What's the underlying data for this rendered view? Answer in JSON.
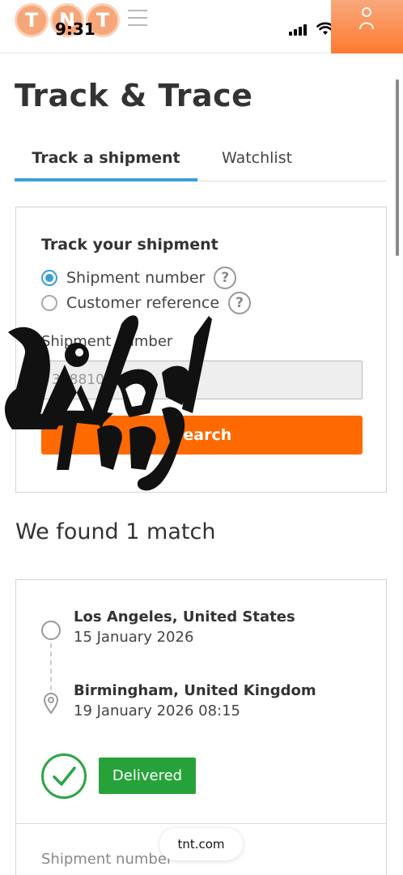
{
  "status_bar": {
    "time": "9:31"
  },
  "header": {
    "logo_letters": [
      "T",
      "N",
      "T"
    ],
    "brand_color": "#ff6a00"
  },
  "page": {
    "title": "Track & Trace"
  },
  "tabs": [
    {
      "label": "Track a shipment",
      "active": true
    },
    {
      "label": "Watchlist",
      "active": false
    }
  ],
  "search_card": {
    "heading": "Track your shipment",
    "options": [
      {
        "label": "Shipment number",
        "selected": true
      },
      {
        "label": "Customer reference",
        "selected": false
      }
    ],
    "help_glyph": "?",
    "field_label": "Shipment number",
    "field_value": "328810162",
    "button_label": "Search"
  },
  "results": {
    "heading": "We found 1 match",
    "origin": {
      "city": "Los Angeles, United States",
      "date": "15 January 2026"
    },
    "destination": {
      "city": "Birmingham, United Kingdom",
      "date": "19 January 2026 08:15"
    },
    "status": "Delivered",
    "status_color": "#27a23b",
    "next_label": "Shipment number"
  },
  "browser": {
    "url": "tnt.com"
  },
  "watermark": {
    "text": "Wizard Trees"
  }
}
